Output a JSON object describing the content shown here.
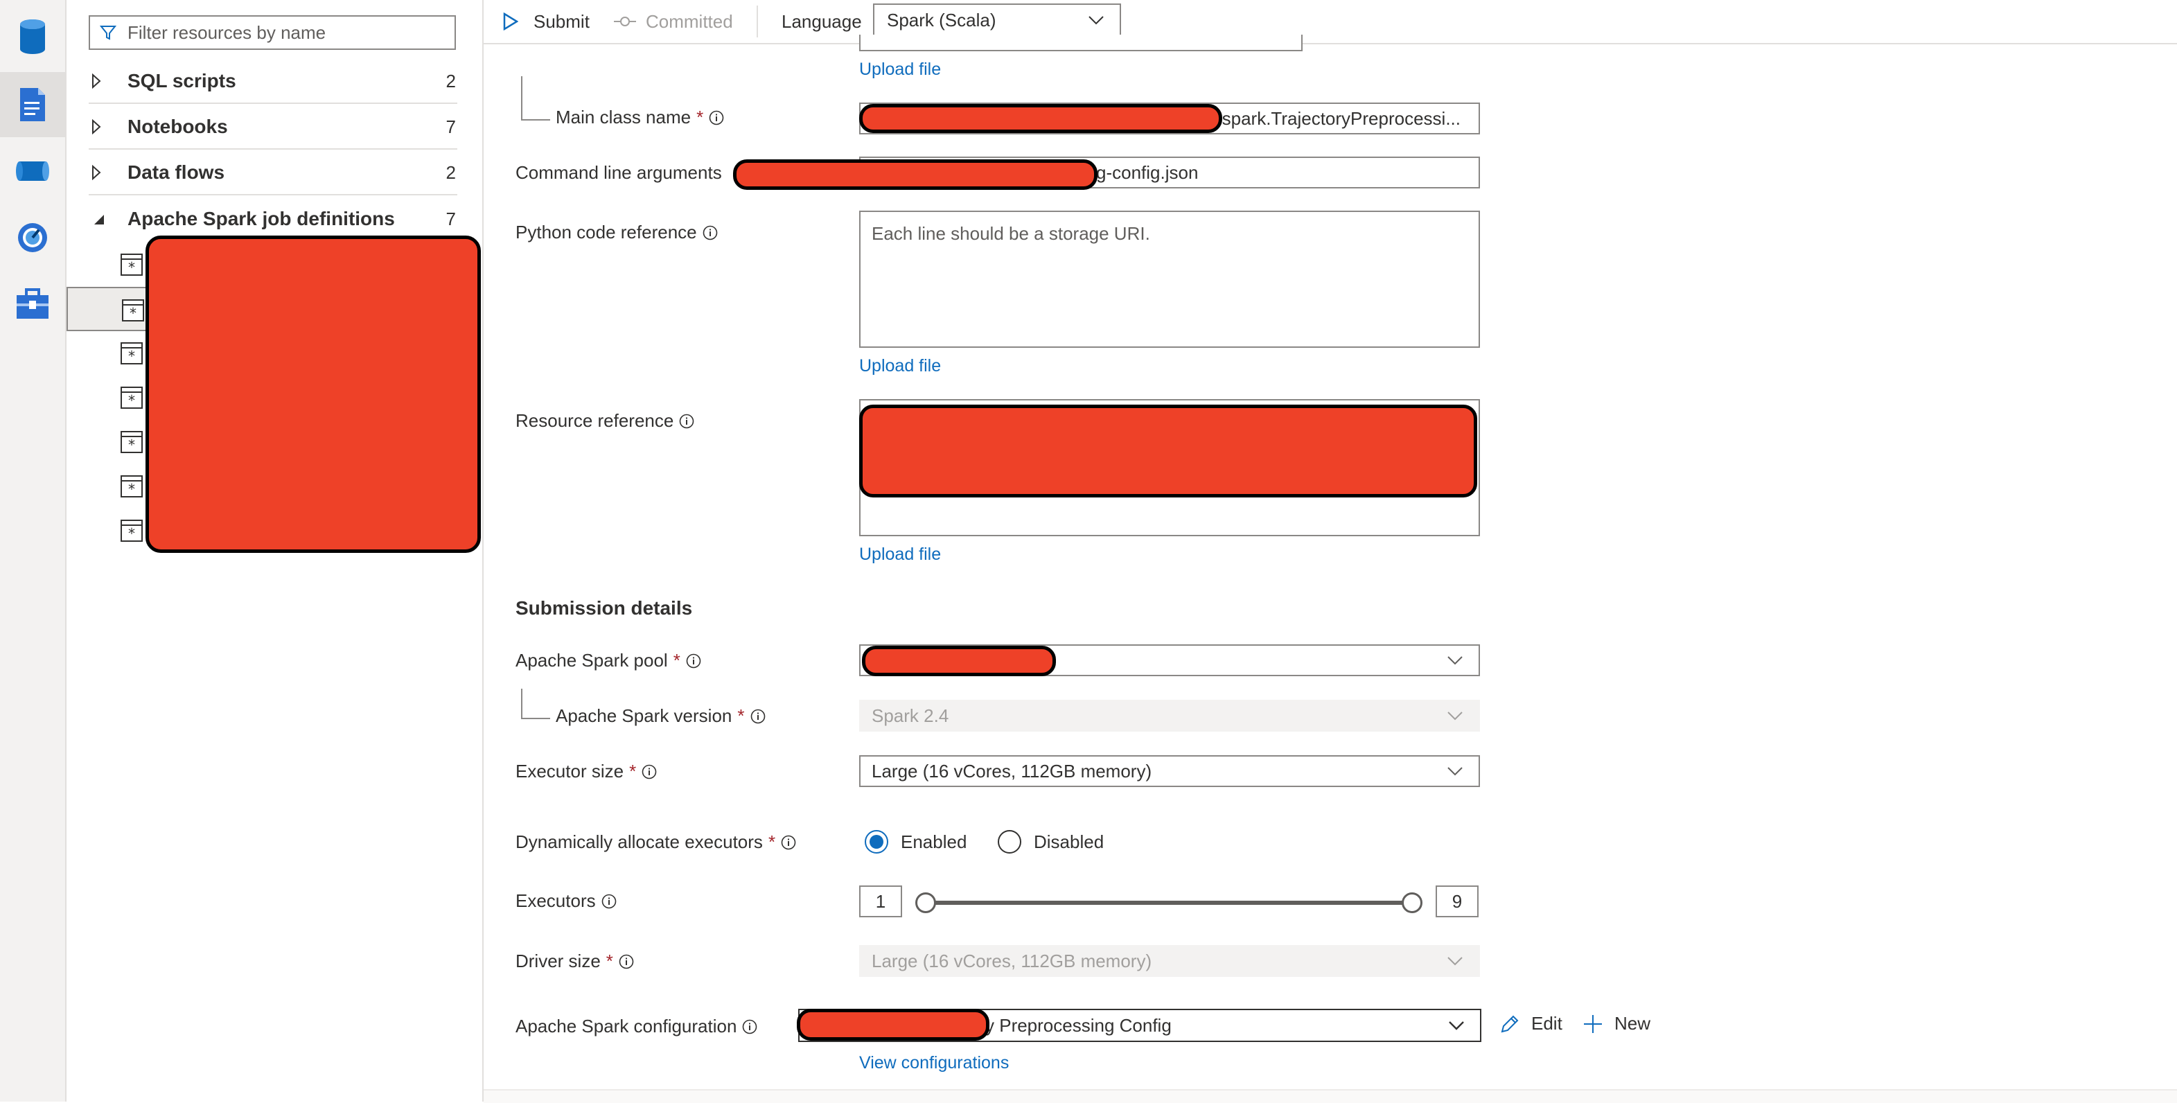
{
  "activity_bar": {
    "items": [
      {
        "icon": "database-icon",
        "active": false
      },
      {
        "icon": "document-icon",
        "active": true
      },
      {
        "icon": "pipeline-icon",
        "active": false
      },
      {
        "icon": "monitor-icon",
        "active": false
      },
      {
        "icon": "toolbox-icon",
        "active": false
      }
    ]
  },
  "explorer": {
    "filter_placeholder": "Filter resources by name",
    "groups": [
      {
        "label": "SQL scripts",
        "count": "2",
        "expanded": false
      },
      {
        "label": "Notebooks",
        "count": "7",
        "expanded": false
      },
      {
        "label": "Data flows",
        "count": "2",
        "expanded": false
      },
      {
        "label": "Apache Spark job definitions",
        "count": "7",
        "expanded": true
      }
    ],
    "job_definition_count": 7,
    "selected_job_index": 1
  },
  "toolbar": {
    "submit_label": "Submit",
    "committed_label": "Committed",
    "language_label": "Language",
    "language_value": "Spark (Scala)"
  },
  "form": {
    "upload_file_label": "Upload file",
    "main_class_label": "Main class name",
    "main_class_value": ".spark.TrajectoryPreprocessi...",
    "command_args_label": "Command line arguments",
    "command_args_value": "g-config.json",
    "python_ref_label": "Python code reference",
    "python_ref_placeholder": "Each line should be a storage URI.",
    "resource_ref_label": "Resource reference",
    "submission_details_title": "Submission details",
    "spark_pool_label": "Apache Spark pool",
    "spark_version_label": "Apache Spark version",
    "spark_version_value": "Spark 2.4",
    "executor_size_label": "Executor size",
    "executor_size_value": "Large (16 vCores, 112GB memory)",
    "dynamic_alloc_label": "Dynamically allocate executors",
    "enabled_label": "Enabled",
    "disabled_label": "Disabled",
    "dynamic_alloc_selected": "Enabled",
    "executors_label": "Executors",
    "executors_min": "1",
    "executors_max": "9",
    "driver_size_label": "Driver size",
    "driver_size_value": "Large (16 vCores, 112GB memory)",
    "spark_config_label": "Apache Spark configuration",
    "spark_config_value": "y Preprocessing Config",
    "edit_label": "Edit",
    "new_label": "New",
    "view_configurations_label": "View configurations"
  },
  "colors": {
    "accent": "#0f6cbd",
    "required": "#a4262c",
    "redaction": "#ee4128"
  }
}
